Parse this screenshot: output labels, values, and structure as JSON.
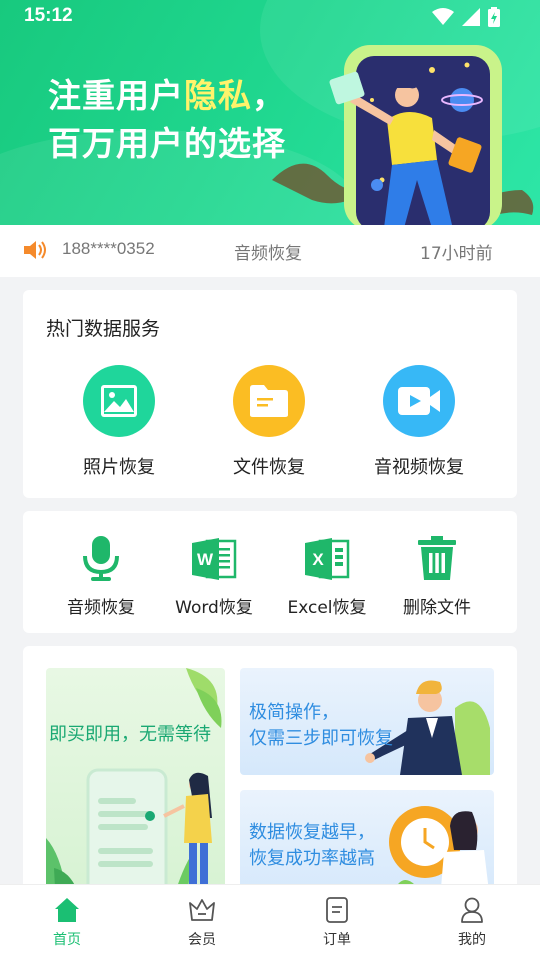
{
  "status_bar": {
    "time": "15:12"
  },
  "hero": {
    "title_line1_part1": "注重用户",
    "title_line1_highlight": "隐私",
    "title_line1_part2": "，",
    "title_line2": "百万用户的选择"
  },
  "notice": {
    "phone": "188****0352",
    "service": "音频恢复",
    "time": "17小时前"
  },
  "hot_services": {
    "title": "热门数据服务",
    "items": [
      {
        "label": "照片恢复",
        "icon": "image-icon",
        "color": "#1fd69b"
      },
      {
        "label": "文件恢复",
        "icon": "folder-icon",
        "color": "#fbbd23"
      },
      {
        "label": "音视频恢复",
        "icon": "video-icon",
        "color": "#37b8f6"
      }
    ]
  },
  "tools": [
    {
      "label": "音频恢复",
      "icon": "microphone-icon"
    },
    {
      "label": "Word恢复",
      "icon": "word-icon"
    },
    {
      "label": "Excel恢复",
      "icon": "excel-icon"
    },
    {
      "label": "删除文件",
      "icon": "trash-icon"
    }
  ],
  "promos": {
    "left": "即买即用，无需等待",
    "right_top_line1": "极简操作，",
    "right_top_line2": "仅需三步即可恢复",
    "right_bottom_line1": "数据恢复越早，",
    "right_bottom_line2": "恢复成功率越高"
  },
  "bottom_nav": [
    {
      "label": "首页",
      "icon": "home-icon",
      "active": true
    },
    {
      "label": "会员",
      "icon": "crown-icon",
      "active": false
    },
    {
      "label": "订单",
      "icon": "order-icon",
      "active": false
    },
    {
      "label": "我的",
      "icon": "user-icon",
      "active": false
    }
  ],
  "colors": {
    "primary": "#1bbf73",
    "accent_yellow": "#fff36b",
    "promo_blue": "#2f8de0"
  }
}
